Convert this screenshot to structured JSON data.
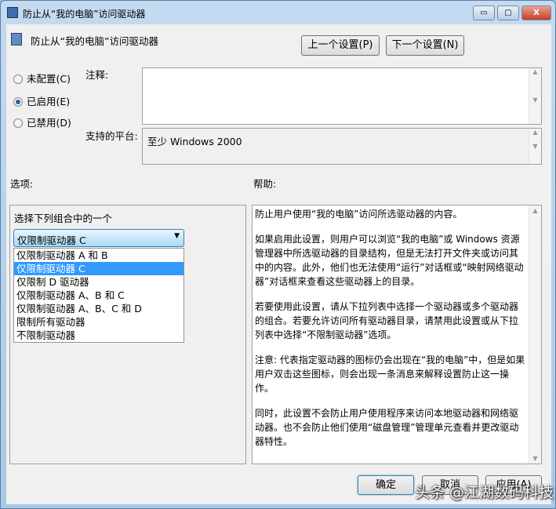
{
  "window": {
    "title": "防止从“我的电脑”访问驱动器",
    "minimize": "▭",
    "maximize": "▢",
    "close": "X"
  },
  "header": {
    "policy_name": "防止从“我的电脑”访问驱动器",
    "prev_button": "上一个设置(P)",
    "next_button": "下一个设置(N)"
  },
  "state": {
    "options": [
      {
        "label": "未配置(C)",
        "checked": false
      },
      {
        "label": "已启用(E)",
        "checked": true
      },
      {
        "label": "已禁用(D)",
        "checked": false
      }
    ]
  },
  "comment": {
    "label": "注释:",
    "value": ""
  },
  "platform": {
    "label": "支持的平台:",
    "value": "至少 Windows 2000"
  },
  "options_section": {
    "label": "选项:",
    "prompt": "选择下列组合中的一个",
    "selected": "仅限制驱动器 C",
    "items": [
      "仅限制驱动器 A 和 B",
      "仅限制驱动器 C",
      "仅限制 D 驱动器",
      "仅限制驱动器 A、B 和 C",
      "仅限制驱动器 A、B、C 和 D",
      "限制所有驱动器",
      "不限制驱动器"
    ]
  },
  "help_section": {
    "label": "帮助:",
    "paragraphs": [
      "防止用户使用“我的电脑”访问所选驱动器的内容。",
      "如果启用此设置，则用户可以浏览“我的电脑”或 Windows 资源管理器中所选驱动器的目录结构，但是无法打开文件夹或访问其中的内容。此外，他们也无法使用“运行”对话框或“映射网络驱动器”对话框来查看这些驱动器上的目录。",
      "若要使用此设置，请从下拉列表中选择一个驱动器或多个驱动器的组合。若要允许访问所有驱动器目录，请禁用此设置或从下拉列表中选择“不限制驱动器”选项。",
      "注意: 代表指定驱动器的图标仍会出现在“我的电脑”中，但是如果用户双击这些图标，则会出现一条消息来解释设置防止这一操作。",
      "同时，此设置不会防止用户使用程序来访问本地驱动器和网络驱动器。也不会防止他们使用“磁盘管理”管理单元查看并更改驱动器特性。"
    ]
  },
  "footer": {
    "ok": "确定",
    "cancel": "取消",
    "apply": "应用(A)"
  },
  "watermark": "头条 @江湖数码科技"
}
